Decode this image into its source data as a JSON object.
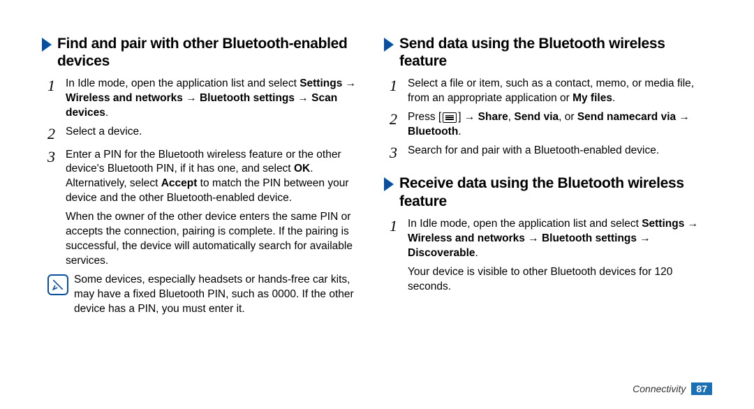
{
  "left": {
    "heading": "Find and pair with other Bluetooth-enabled devices",
    "step1_a": "In Idle mode, open the application list and select ",
    "step1_b": "Settings → Wireless and networks → Bluetooth settings → Scan devices",
    "step1_c": ".",
    "step2": "Select a device.",
    "step3_a": "Enter a PIN for the Bluetooth wireless feature or the other device's Bluetooth PIN, if it has one, and select ",
    "step3_b": "OK",
    "step3_c": ". Alternatively, select ",
    "step3_d": "Accept",
    "step3_e": " to match the PIN between your device and the other Bluetooth-enabled device.",
    "step3_sub": "When the owner of the other device enters the same PIN or accepts the connection, pairing is complete. If the pairing is successful, the device will automatically search for available services.",
    "note": "Some devices, especially headsets or hands-free car kits, may have a fixed Bluetooth PIN, such as 0000. If the other device has a PIN, you must enter it."
  },
  "right": {
    "send_heading": "Send data using the Bluetooth wireless feature",
    "send1_a": "Select a file or item, such as a contact, memo, or media file, from an appropriate application or ",
    "send1_b": "My files",
    "send1_c": ".",
    "send2_a": "Press [",
    "send2_b": "] → ",
    "send2_c": "Share",
    "send2_d": ", ",
    "send2_e": "Send via",
    "send2_f": ", or ",
    "send2_g": "Send namecard via",
    "send2_h": " → ",
    "send2_i": "Bluetooth",
    "send2_j": ".",
    "send3": "Search for and pair with a Bluetooth-enabled device.",
    "recv_heading": "Receive data using the Bluetooth wireless feature",
    "recv1_a": "In Idle mode, open the application list and select ",
    "recv1_b": "Settings → Wireless and networks → Bluetooth settings → Discoverable",
    "recv1_c": ".",
    "recv1_sub": "Your device is visible to other Bluetooth devices for 120 seconds."
  },
  "nums": {
    "n1": "1",
    "n2": "2",
    "n3": "3"
  },
  "footer": {
    "section": "Connectivity",
    "page": "87"
  }
}
